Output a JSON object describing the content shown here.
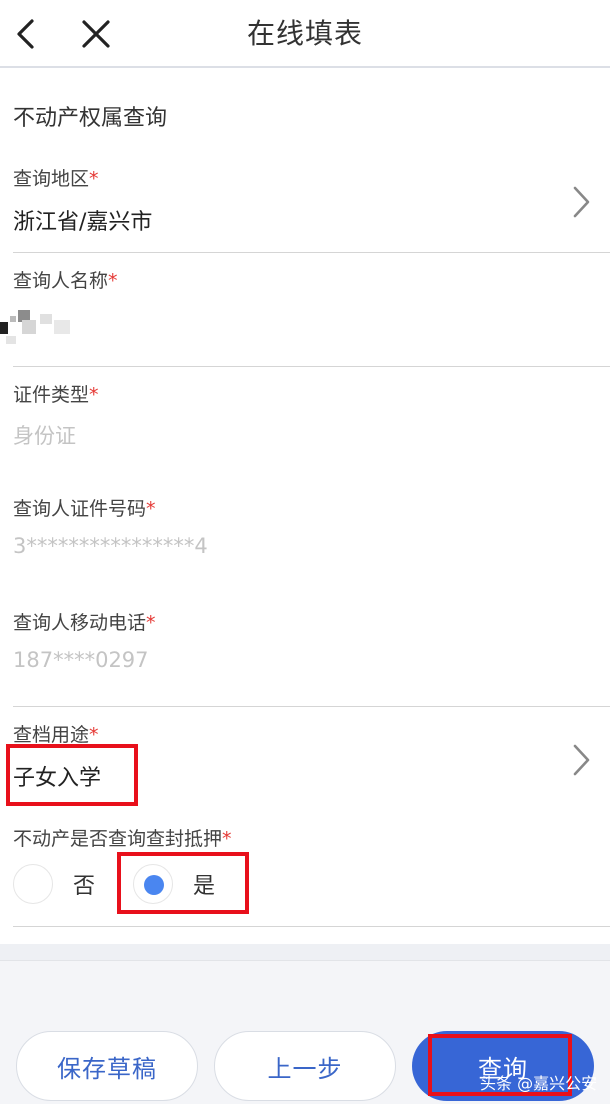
{
  "header": {
    "title": "在线填表",
    "back_icon": "chevron-left-icon",
    "close_icon": "close-icon"
  },
  "form": {
    "title": "不动产权属查询",
    "required_mark": "*",
    "region": {
      "label": "查询地区",
      "value": "浙江省/嘉兴市"
    },
    "applicant_name": {
      "label": "查询人名称"
    },
    "id_type": {
      "label": "证件类型",
      "value": "身份证"
    },
    "id_number": {
      "label": "查询人证件号码",
      "value": "3****************4"
    },
    "phone": {
      "label": "查询人移动电话",
      "value": "187****0297"
    },
    "purpose": {
      "label": "查档用途",
      "value": "子女入学"
    },
    "seizure_query": {
      "label": "不动产是否查询查封抵押",
      "options": [
        "否",
        "是"
      ],
      "selected": "是"
    }
  },
  "footer": {
    "save_draft": "保存草稿",
    "prev_step": "上一步",
    "query": "查询"
  },
  "watermark": "头条 @嘉兴公安",
  "colors": {
    "primary": "#3766d6",
    "highlight_box": "#e8101b",
    "required": "#e53935",
    "radio_selected": "#4a86f0"
  }
}
